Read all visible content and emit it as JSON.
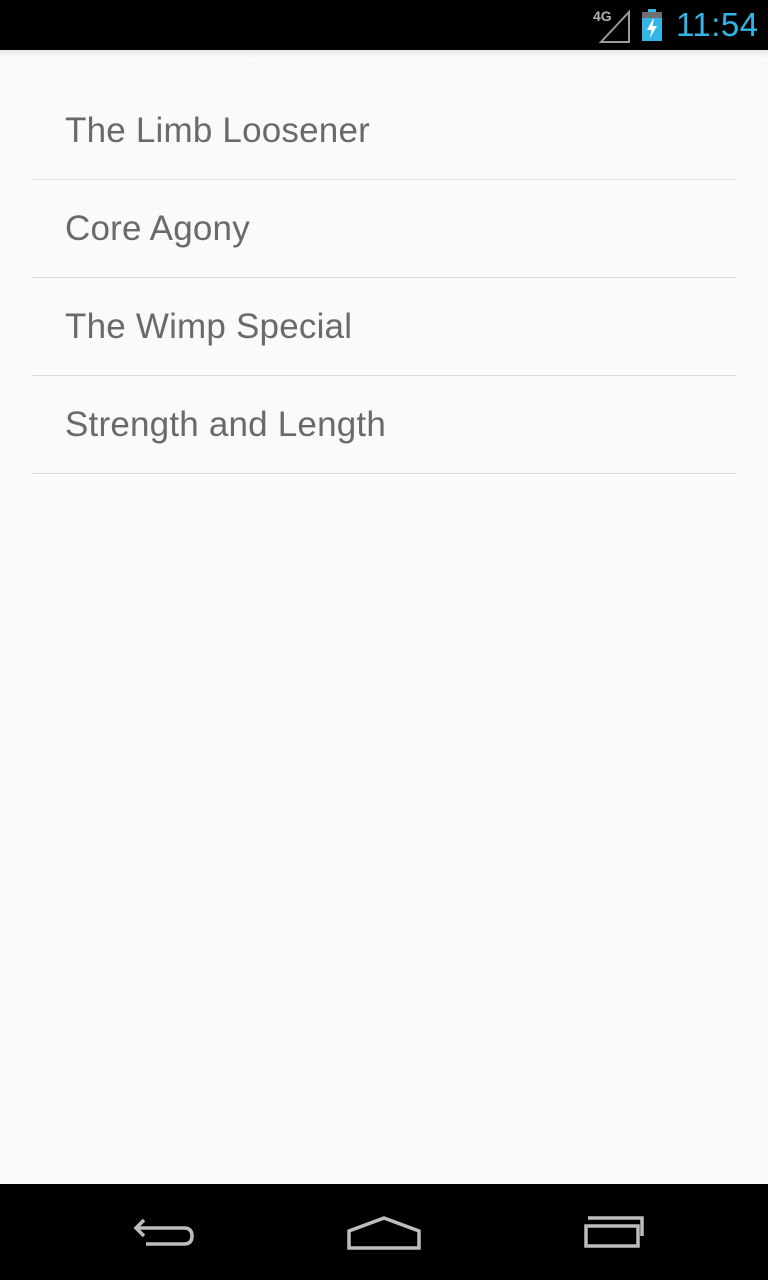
{
  "status_bar": {
    "network_label": "4G",
    "time": "11:54",
    "time_color": "#33b5e5",
    "icons": [
      "signal-icon",
      "battery-charging-icon"
    ]
  },
  "workouts": {
    "items": [
      {
        "label": "The Limb Loosener"
      },
      {
        "label": "Core Agony"
      },
      {
        "label": "The Wimp Special"
      },
      {
        "label": "Strength and Length"
      }
    ]
  },
  "nav_bar": {
    "icons": [
      "back-icon",
      "home-icon",
      "recents-icon"
    ]
  }
}
